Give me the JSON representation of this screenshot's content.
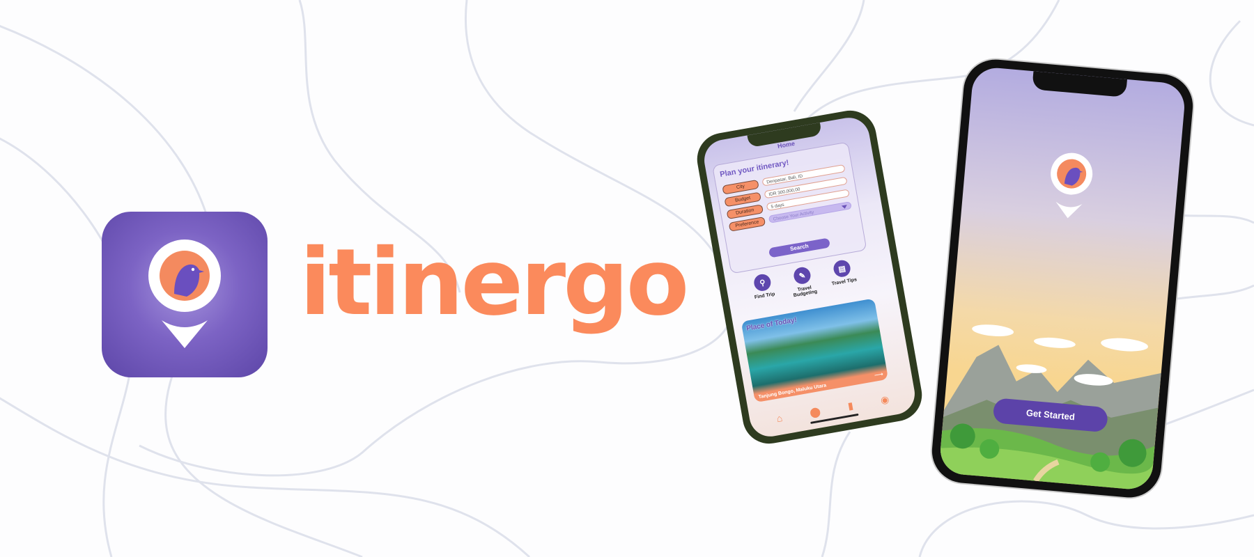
{
  "brand": {
    "name": "itinergo"
  },
  "colors": {
    "brand_orange": "#fb8a5c",
    "brand_purple": "#6a52b8",
    "background": "#fdfdfe"
  },
  "phone_home": {
    "screen_title": "Home",
    "plan_title": "Plan your itinerary!",
    "fields": [
      {
        "label": "City",
        "value": "Denpasar, Bali, ID"
      },
      {
        "label": "Budget",
        "value": "IDR 300,000,00"
      },
      {
        "label": "Duration",
        "value": "5 days"
      },
      {
        "label": "Preference",
        "value": "Choose Your Activity"
      }
    ],
    "search_label": "Search",
    "features": [
      {
        "label": "Find Trip",
        "icon": "find-trip-icon"
      },
      {
        "label": "Travel Budgeting",
        "icon": "budget-icon"
      },
      {
        "label": "Travel Tips",
        "icon": "book-icon"
      }
    ],
    "place": {
      "title": "Place of Today!",
      "caption": "Tanjung Bongo, Maluku Utara"
    },
    "tabs": [
      "home-icon",
      "map-pin-icon",
      "bookmark-icon",
      "profile-icon"
    ]
  },
  "phone_welcome": {
    "button_label": "Get Started"
  }
}
